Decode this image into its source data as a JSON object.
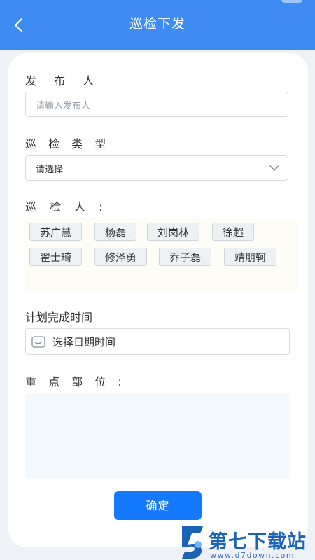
{
  "header": {
    "title": "巡检下发",
    "back_icon": "chevron-left-icon",
    "background": "#3e8cf2"
  },
  "form": {
    "publisher": {
      "label": "发 布 人",
      "placeholder": "请输入发布人"
    },
    "type": {
      "label": "巡 检 类 型",
      "selected": "请选择",
      "icon": "chevron-down-icon"
    },
    "inspectors": {
      "label": "巡 检 人 :",
      "chips": [
        "苏广慧",
        "杨磊",
        "刘岗林",
        "徐超",
        "翟士琦",
        "修泽勇",
        "乔子磊",
        "靖朋轲"
      ]
    },
    "plan_time": {
      "label": "计划完成时间",
      "value": "选择日期时间",
      "icon": "calendar-icon"
    },
    "key_area": {
      "label": "重 点 部 位 :",
      "value": ""
    },
    "confirm_label": "确定",
    "accent": "#1479ff"
  },
  "watermark": {
    "name": "第七下载站",
    "url": "www.d7down.com"
  }
}
